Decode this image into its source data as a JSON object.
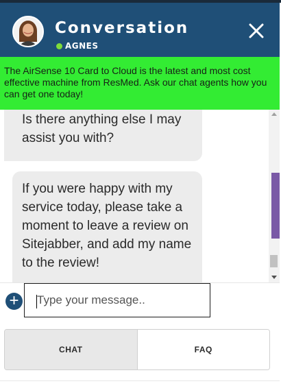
{
  "header": {
    "title": "Conversation",
    "agent_name": "AGNES",
    "status_color": "#7fdc3a",
    "background": "#1f4f77",
    "close_icon": "close-icon",
    "avatar": "agent-avatar"
  },
  "promo": {
    "text": "The AirSense 10 Card to Cloud is the latest and most cost effective machine from ResMed. Ask our chat agents how you can get one today!",
    "background": "#33ec33"
  },
  "messages": [
    {
      "sender": "agent",
      "text": "Is there anything else I may assist you with?"
    },
    {
      "sender": "agent",
      "text": "If you were happy with my service today, please take a moment to leave a review on Sitejabber, and add my name to the review!"
    }
  ],
  "composer": {
    "placeholder": "Type your message..",
    "value": "",
    "add_icon": "plus-icon"
  },
  "tabs": [
    {
      "label": "CHAT",
      "active": true
    },
    {
      "label": "FAQ",
      "active": false
    }
  ]
}
